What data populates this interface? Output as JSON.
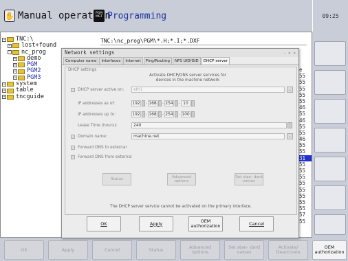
{
  "header": {
    "mode_manual": "Manual operation",
    "mode_programming": "Programming",
    "pgm_icon_text": "PGM\nMGT",
    "clock": "09:25"
  },
  "file_browser": {
    "path": "TNC:\\nc_prog\\PGM\\*.H;*.I;*.DXF",
    "tree": [
      {
        "label": "TNC:\\",
        "indent": 0,
        "blue": false
      },
      {
        "label": "lost+found",
        "indent": 1,
        "blue": false
      },
      {
        "label": "nc_prog",
        "indent": 1,
        "blue": false
      },
      {
        "label": "demo",
        "indent": 2,
        "blue": false
      },
      {
        "label": "PGM",
        "indent": 2,
        "blue": true
      },
      {
        "label": "PGM2",
        "indent": 2,
        "blue": true
      },
      {
        "label": "PGM3",
        "indent": 2,
        "blue": true
      },
      {
        "label": "system",
        "indent": 0,
        "blue": false
      },
      {
        "label": "table",
        "indent": 0,
        "blue": false
      },
      {
        "label": "tncguide",
        "indent": 0,
        "blue": false
      }
    ],
    "right_values": [
      "e",
      "55",
      "55",
      "55",
      "55",
      "55",
      "46",
      "55",
      "46",
      "55",
      "55",
      "46",
      "55",
      "55",
      "31",
      "55",
      "55",
      "55",
      "55",
      "55",
      "55",
      "55",
      "55",
      "57",
      "55"
    ],
    "selected_index": 14
  },
  "dialog": {
    "title": "Network settings",
    "window_controls": "- ▫ ×",
    "tabs": [
      "Computer name",
      "Interfaces",
      "Internet",
      "Ping/Routing",
      "NFS UID/GID",
      "DHCP server"
    ],
    "active_tab": 5,
    "group_label": "DHCP settings",
    "activate_text": "Activate DHCP/DNS server services for devices in the machine network",
    "dhcp_active_label": "DHCP server active on:",
    "dhcp_interface": "eth1",
    "ip_from_label": "IP addresses as of:",
    "ip_from": [
      "192",
      "168",
      "254",
      "10"
    ],
    "ip_to_label": "IP addresses up to:",
    "ip_to": [
      "192",
      "168",
      "254",
      "100"
    ],
    "lease_label": "Lease Time (hours):",
    "lease_value": "240",
    "domain_label": "Domain name:",
    "domain_value": "machine.net",
    "fwd_dns_label": "Forward DNS to external",
    "fwd_dns_from_label": "Forward DNS from external",
    "status_btn": "Status",
    "advanced_btn": "Advanced options",
    "set_std_btn": "Set stan- dard values",
    "note": "The DHCP server service cannot be activated on the primary interface.",
    "ok_btn": "OK",
    "apply_btn": "Apply",
    "oem_btn": "OEM authorization",
    "cancel_btn": "Cancel"
  },
  "softkeys": [
    "OK",
    "Apply",
    "Cancel",
    "Status",
    "Advanced options",
    "Set stan- dard values",
    "Activate/ Deactivate",
    "OEM authorization"
  ],
  "active_softkey": 7
}
